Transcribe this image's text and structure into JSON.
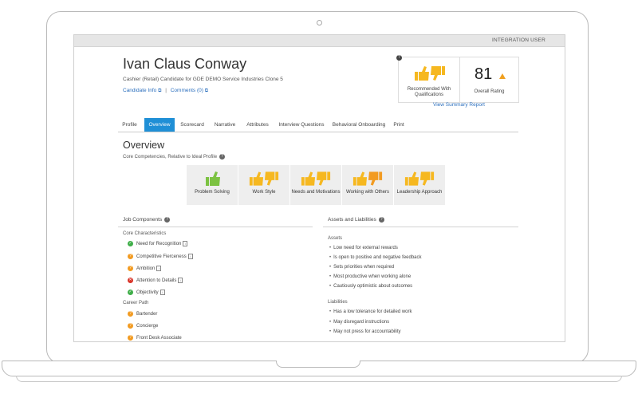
{
  "topbar": {
    "user_label": "INTEGRATION USER"
  },
  "candidate": {
    "name": "Ivan Claus Conway",
    "subtitle": "Cashier (Retail) Candidate for GDE DEMO Service Industries Clone 5",
    "info_link": "Candidate Info",
    "separator": "|",
    "comments_link": "Comments (0)"
  },
  "summary": {
    "help_mark": "?",
    "recommendation_label": "Recommended With Qualifications",
    "overall_value": "81",
    "overall_label": "Overall Rating",
    "view_link": "View Summary Report"
  },
  "tabs": [
    {
      "label": "Profile"
    },
    {
      "label": "Overview",
      "active": true
    },
    {
      "label": "Scorecard"
    },
    {
      "label": "Narrative"
    },
    {
      "label": "Attributes"
    },
    {
      "label": "Interview Questions"
    },
    {
      "label": "Behavioral Onboarding"
    },
    {
      "label": "Print"
    }
  ],
  "overview": {
    "title": "Overview",
    "core_label": "Core Competencies, Relative to Ideal Profile",
    "help_mark": "?",
    "competencies": [
      {
        "label": "Problem Solving",
        "rating": "thumbs-up",
        "color": "#7cc242"
      },
      {
        "label": "Work Style",
        "rating": "mixed",
        "color": "#f6b820"
      },
      {
        "label": "Needs and Motivations",
        "rating": "mixed",
        "color": "#f6b820"
      },
      {
        "label": "Working with Others",
        "rating": "mixed-orange",
        "color": "#f29b22"
      },
      {
        "label": "Leadership Approach",
        "rating": "mixed",
        "color": "#f6b820"
      }
    ]
  },
  "job_components": {
    "heading": "Job Components",
    "help_mark": "?",
    "core_heading": "Core Characteristics",
    "info_mark": "i",
    "core_items": [
      {
        "label": "Need for Recognition",
        "status": "green",
        "mark": "✓"
      },
      {
        "label": "Competitive Fierceness",
        "status": "orange",
        "mark": "?"
      },
      {
        "label": "Ambition",
        "status": "orange",
        "mark": "?"
      },
      {
        "label": "Attention to Details",
        "status": "red",
        "mark": "✕"
      },
      {
        "label": "Objectivity",
        "status": "green",
        "mark": "✓"
      }
    ],
    "career_heading": "Career Path",
    "career_items": [
      {
        "label": "Bartender",
        "status": "orange",
        "mark": "?"
      },
      {
        "label": "Concierge",
        "status": "orange",
        "mark": "?"
      },
      {
        "label": "Front Desk Associate",
        "status": "orange",
        "mark": "?"
      }
    ]
  },
  "assets_liabilities": {
    "heading": "Assets and Liabilities",
    "help_mark": "?",
    "assets_heading": "Assets",
    "assets": [
      "Low need for external rewards",
      "Is open to positive and negative feedback",
      "Sets priorities when required",
      "Most productive when working alone",
      "Cautiously optimistic about outcomes"
    ],
    "liabilities_heading": "Liabilities",
    "liabilities": [
      "Has a low tolerance for detailed work",
      "May disregard instructions",
      "May not press for accountability"
    ]
  }
}
